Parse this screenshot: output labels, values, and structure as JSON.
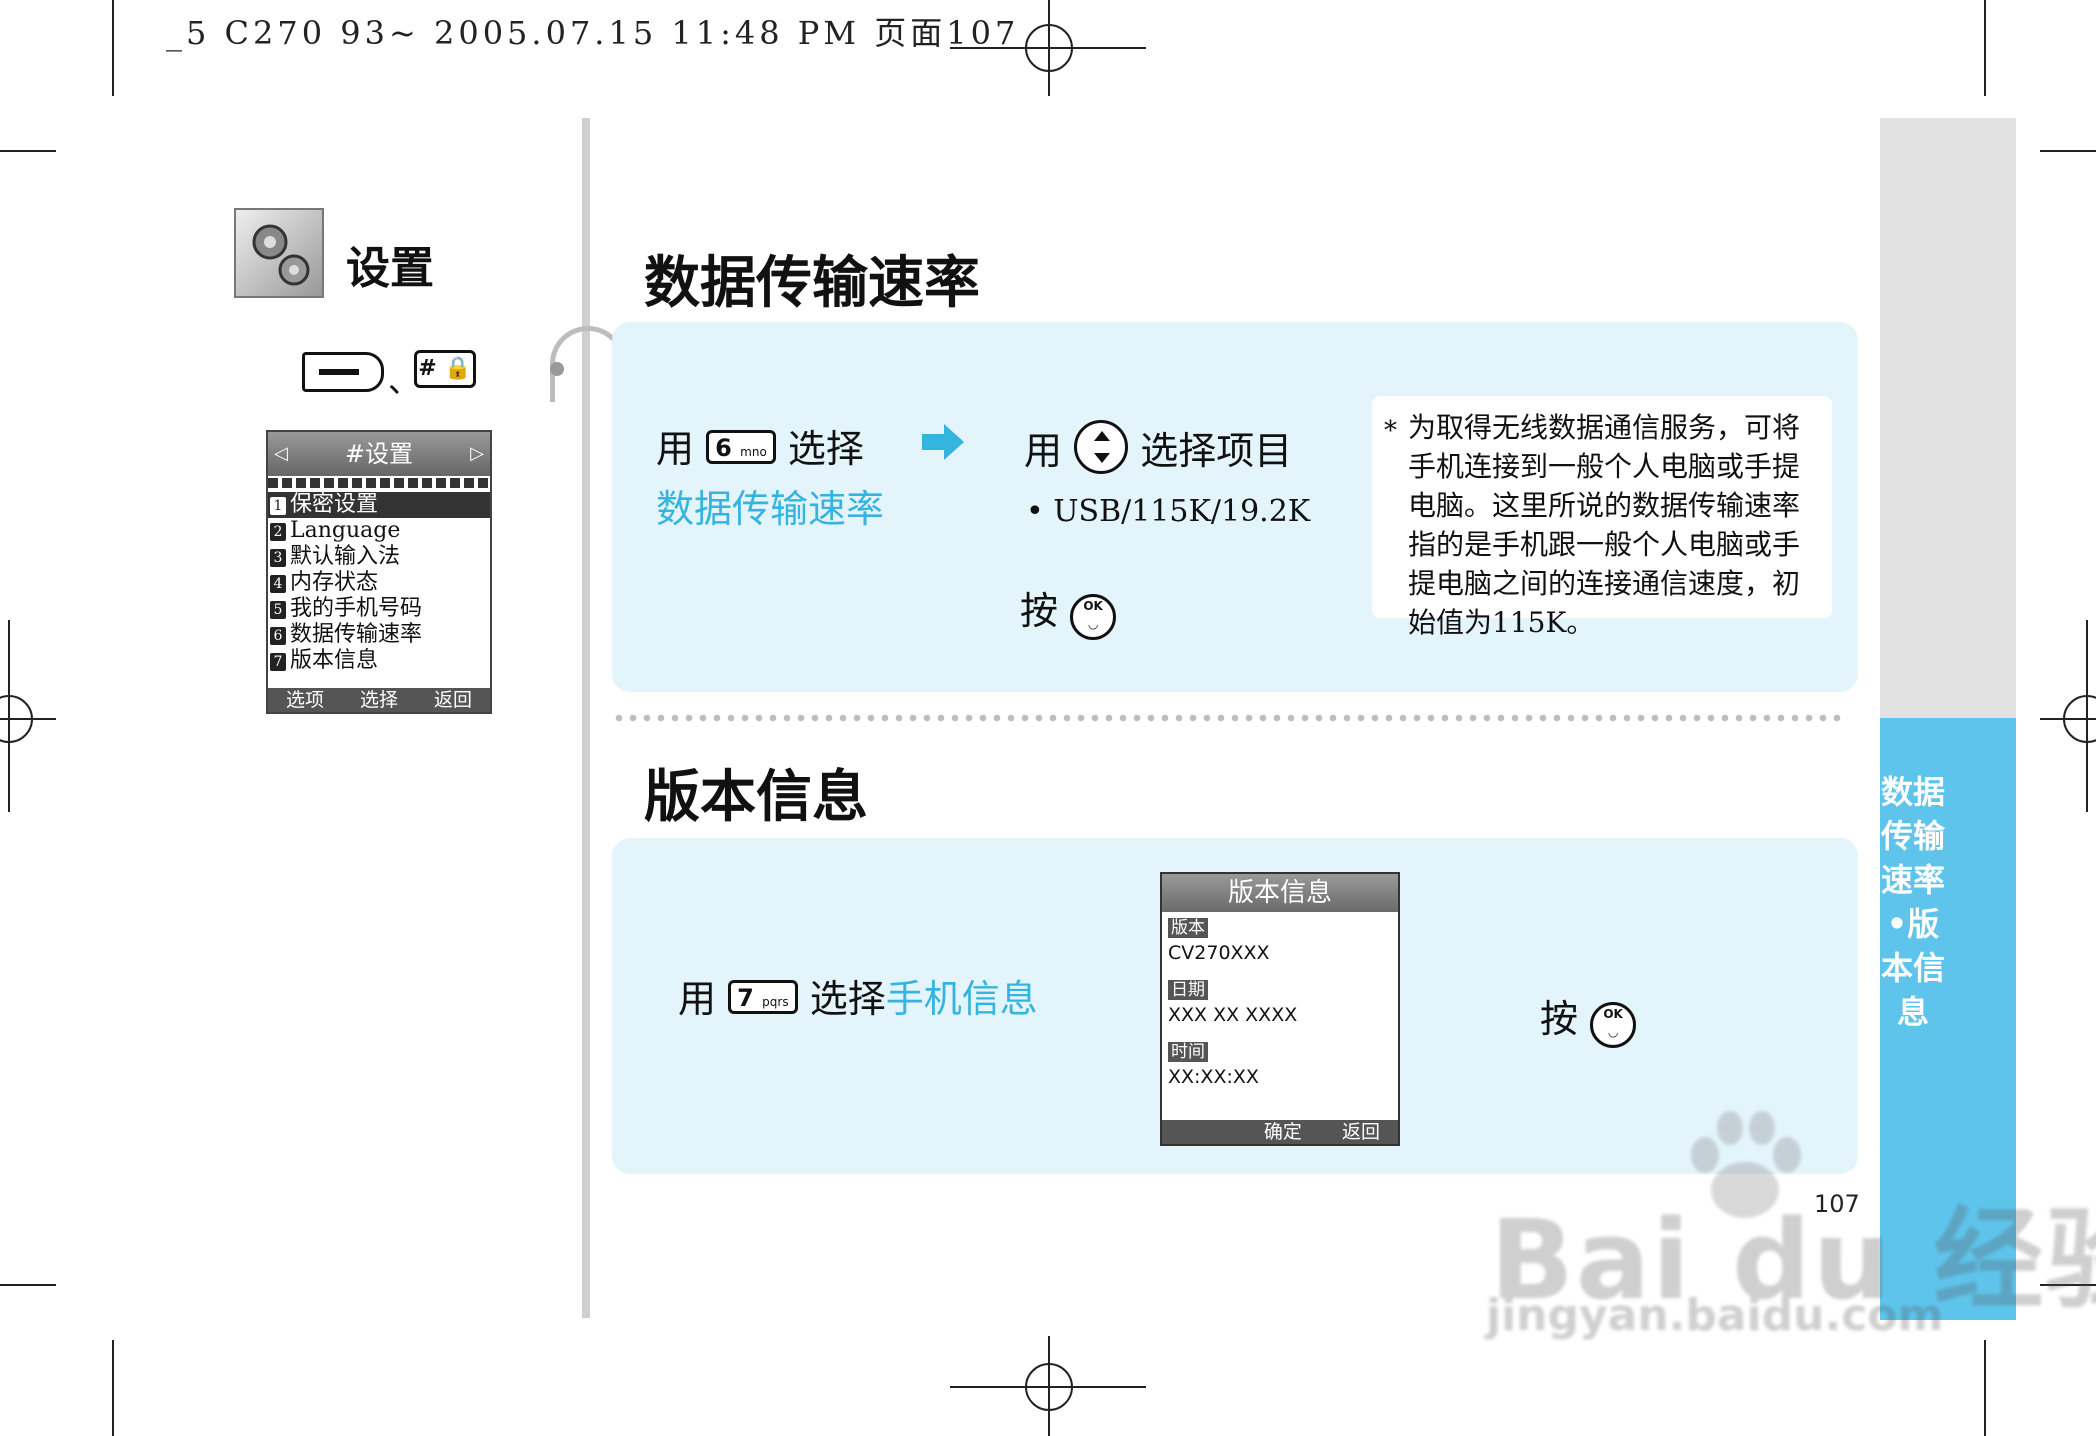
{
  "header": {
    "meta": "_5 C270 93~ 2005.07.15 11:48 PM 页面107"
  },
  "sidebar": {
    "title": "设置",
    "separator": "、",
    "hash_key": "# 🔒",
    "phone_menu": {
      "title": "#设置",
      "items": [
        {
          "num": "1",
          "label": "保密设置"
        },
        {
          "num": "2",
          "label": "Language"
        },
        {
          "num": "3",
          "label": "默认输入法"
        },
        {
          "num": "4",
          "label": "内存状态"
        },
        {
          "num": "5",
          "label": "我的手机号码"
        },
        {
          "num": "6",
          "label": "数据传输速率"
        },
        {
          "num": "7",
          "label": "版本信息"
        }
      ],
      "softkeys": [
        "选项",
        "选择",
        "返回"
      ]
    }
  },
  "section1": {
    "title": "数据传输速率",
    "step1_prefix": "用",
    "key6": "6",
    "key6_sub": "mno",
    "step1_suffix": "选择",
    "step1_target": "数据传输速率",
    "step2_prefix": "用",
    "step2_suffix": "选择项目",
    "options": "• USB/115K/19.2K",
    "press": "按",
    "ok_label": "OK",
    "note_marker": "*",
    "note": "为取得无线数据通信服务，可将手机连接到一般个人电脑或手提电脑。这里所说的数据传输速率指的是手机跟一般个人电脑或手提电脑之间的连接通信速度，初始值为115K。"
  },
  "section2": {
    "title": "版本信息",
    "step_prefix": "用",
    "key7": "7",
    "key7_sub": "pqrs",
    "step_suffix": "选择",
    "step_target": "手机信息",
    "press": "按",
    "ok_label": "OK",
    "screen": {
      "title": "版本信息",
      "version_tag": "版本",
      "version_value": "CV270XXX",
      "date_tag": "日期",
      "date_value": "XXX XX XXXX",
      "time_tag": "时间",
      "time_value": "XX:XX:XX",
      "softkeys": [
        "确定",
        "返回"
      ]
    }
  },
  "side_tab": {
    "label": "数据传输速率•版本信息"
  },
  "page_number": "107",
  "watermark": {
    "line1": "Bai du 经验",
    "line2": "jingyan.baidu.com"
  },
  "colors": {
    "accent": "#35b4df",
    "panel": "#e3f4fb",
    "tab": "#5fc4ec"
  }
}
